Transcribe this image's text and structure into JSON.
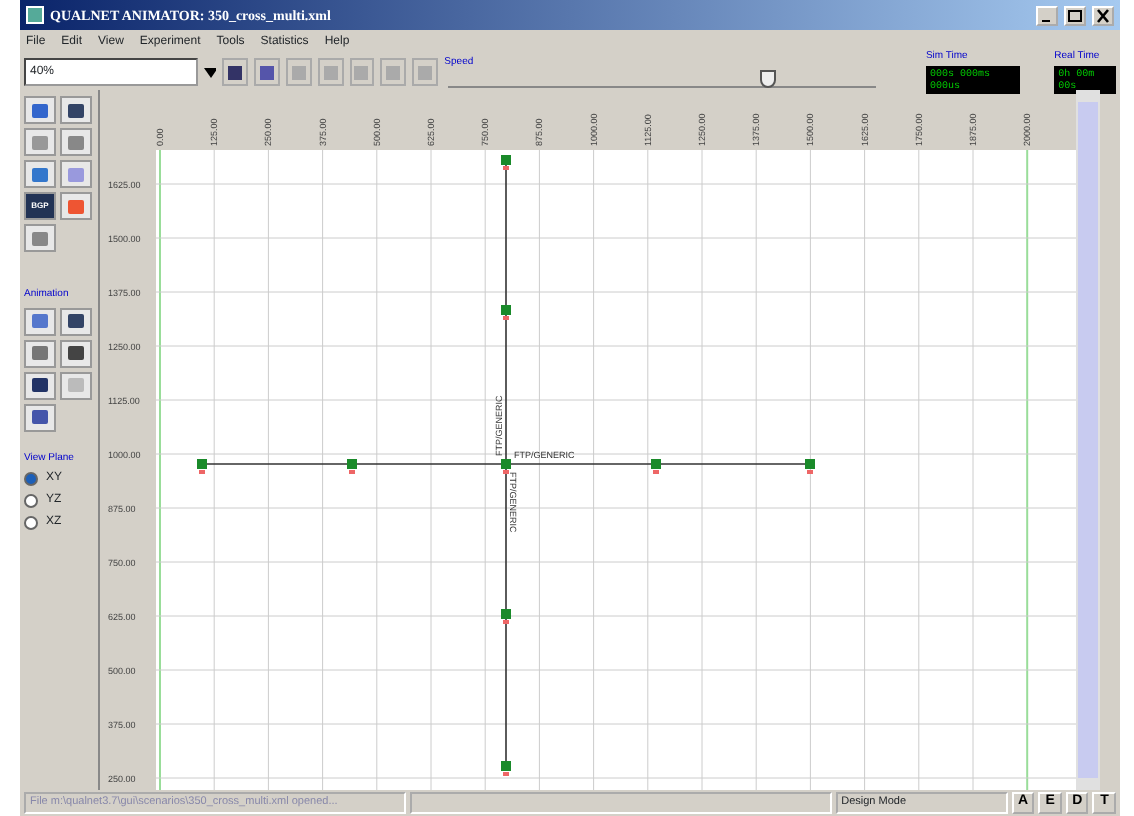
{
  "window": {
    "title": "QUALNET ANIMATOR: 350_cross_multi.xml"
  },
  "menu": [
    "File",
    "Edit",
    "View",
    "Experiment",
    "Tools",
    "Statistics",
    "Help"
  ],
  "toolbar": {
    "zoom": "40%",
    "speed_label": "Speed",
    "speed": {
      "level": 0.73
    },
    "sim_time_label": "Sim Time",
    "sim_time": "000s 000ms 000us",
    "real_time_label": "Real Time",
    "real_time": "0h 00m 00s"
  },
  "toolbox": {
    "bgp_label": "BGP",
    "animation_label": "Animation",
    "view_plane_label": "View Plane",
    "view_plane": [
      {
        "label": "XY",
        "selected": true
      },
      {
        "label": "YZ",
        "selected": false
      },
      {
        "label": "XZ",
        "selected": false
      }
    ]
  },
  "x_ruler": [
    "0.00",
    "125.00",
    "250.00",
    "375.00",
    "500.00",
    "625.00",
    "750.00",
    "875.00",
    "1000.00",
    "1125.00",
    "1250.00",
    "1375.00",
    "1500.00",
    "1625.00",
    "1750.00",
    "1875.00",
    "2000.00"
  ],
  "y_ruler": [
    "1625.00",
    "1500.00",
    "1375.00",
    "1250.00",
    "1125.00",
    "1000.00",
    "875.00",
    "750.00",
    "625.00",
    "500.00",
    "375.00",
    "250.00"
  ],
  "flows": [
    {
      "label": "FTP/GENERIC",
      "kind": "horizontal"
    },
    {
      "label": "FTP/GENERIC",
      "kind": "up"
    },
    {
      "label": "FTP/GENERIC",
      "kind": "down"
    }
  ],
  "status_bar": {
    "message": "File m:\\qualnet3.7\\gui\\scenarios\\350_cross_multi.xml opened...",
    "mode": "Design Mode",
    "buttons": [
      "A",
      "E",
      "D",
      "T"
    ]
  }
}
